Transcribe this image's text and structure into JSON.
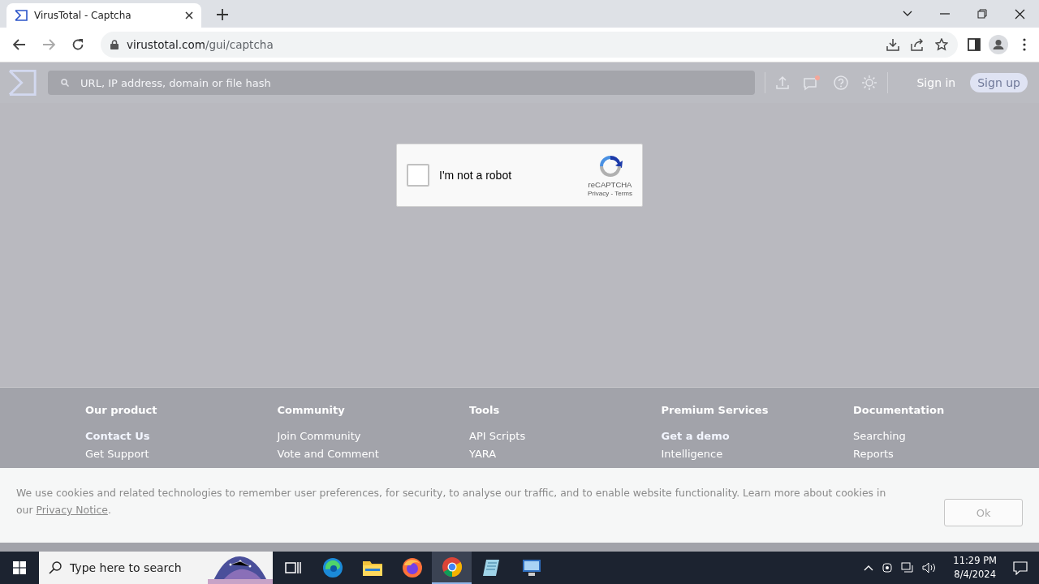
{
  "browser": {
    "tabs": [
      {
        "title": "VirusTotal - Captcha",
        "selected": true
      }
    ],
    "address": {
      "domain": "virustotal.com",
      "path": "/gui/captcha"
    }
  },
  "site_header": {
    "search": {
      "placeholder": "URL, IP address, domain or file hash"
    },
    "has_notification": true,
    "sign_in": "Sign in",
    "sign_up": "Sign up"
  },
  "captcha": {
    "label": "I'm not a robot",
    "checked": false,
    "brand": "reCAPTCHA",
    "links": "Privacy - Terms"
  },
  "footer": {
    "columns": [
      {
        "heading": "Our product",
        "links": [
          {
            "label": "Contact Us",
            "highlighted": true
          },
          {
            "label": "Get Support",
            "highlighted": false
          }
        ]
      },
      {
        "heading": "Community",
        "links": [
          {
            "label": "Join Community",
            "highlighted": false
          },
          {
            "label": "Vote and Comment",
            "highlighted": false
          }
        ]
      },
      {
        "heading": "Tools",
        "links": [
          {
            "label": "API Scripts",
            "highlighted": false
          },
          {
            "label": "YARA",
            "highlighted": false
          }
        ]
      },
      {
        "heading": "Premium Services",
        "links": [
          {
            "label": "Get a demo",
            "highlighted": true
          },
          {
            "label": "Intelligence",
            "highlighted": false
          }
        ]
      },
      {
        "heading": "Documentation",
        "links": [
          {
            "label": "Searching",
            "highlighted": false
          },
          {
            "label": "Reports",
            "highlighted": false
          }
        ]
      }
    ]
  },
  "cookie_banner": {
    "text": "We use cookies and related technologies to remember user preferences, for security, to analyse our traffic, and to enable website functionality. Learn more about cookies in our",
    "link": "Privacy Notice",
    "tail": ".",
    "button": "Ok"
  },
  "taskbar": {
    "search_placeholder": "Type here to search",
    "apps": [
      {
        "kind": "taskview",
        "selected": false
      },
      {
        "kind": "edge",
        "selected": false
      },
      {
        "kind": "explorer",
        "selected": false
      },
      {
        "kind": "firefox",
        "selected": false
      },
      {
        "kind": "chrome",
        "selected": true
      },
      {
        "kind": "notepad",
        "selected": false
      },
      {
        "kind": "monitor",
        "selected": false
      }
    ],
    "time": "11:29 PM",
    "date": "8/4/2024"
  }
}
